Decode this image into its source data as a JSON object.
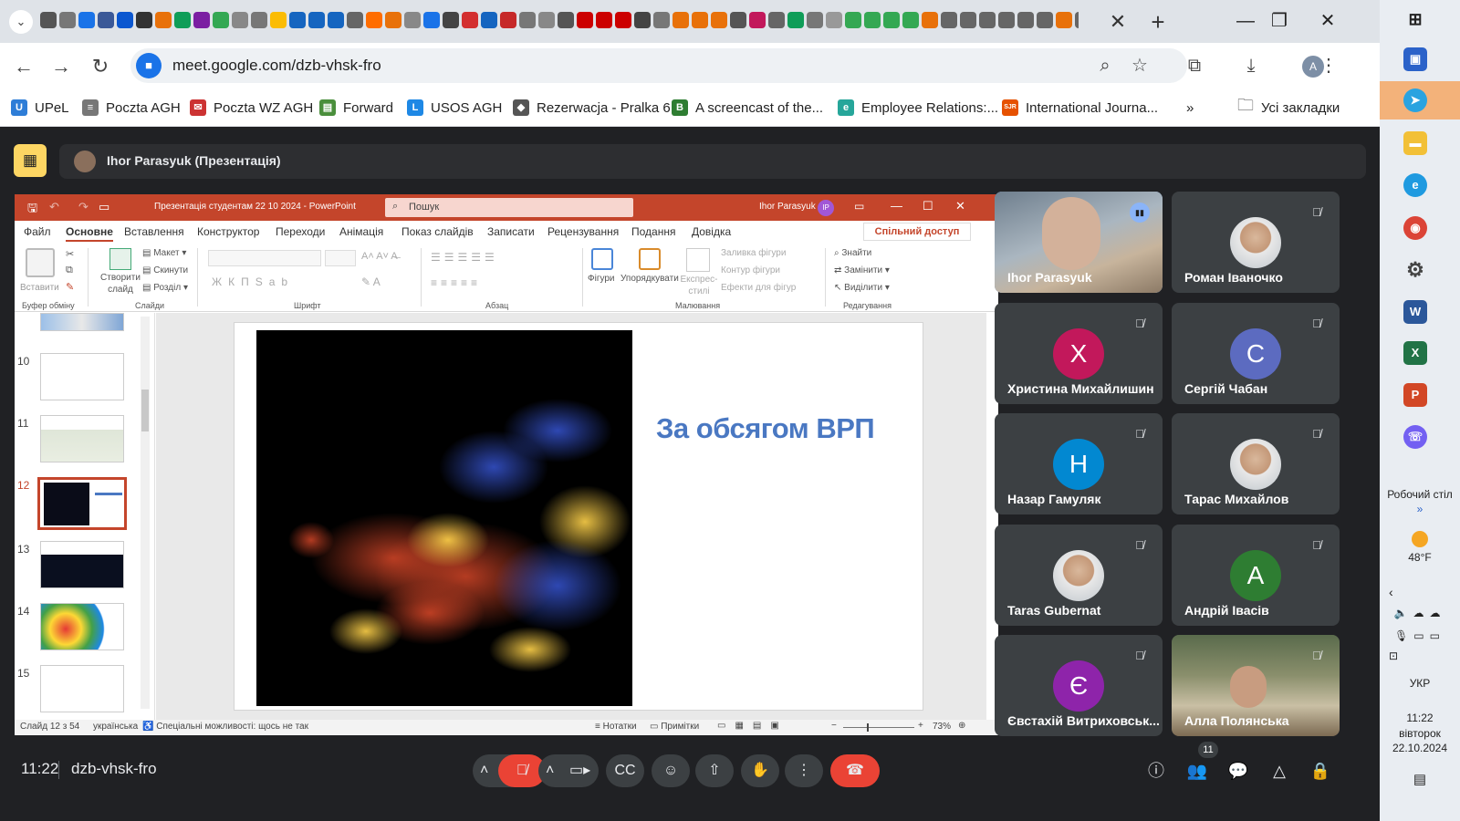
{
  "browser": {
    "url": "meet.google.com/dzb-vhsk-fro",
    "tab_close": "✕",
    "new_tab": "+",
    "tab_favicon_colors": [
      "#555",
      "#777",
      "#1a73e8",
      "#3b5998",
      "#0b57d0",
      "#333",
      "#e8710a",
      "#0f9d58",
      "#7b1fa2",
      "#34a853",
      "#888",
      "#777",
      "#fbbc04",
      "#1565c0",
      "#1565c0",
      "#1565c0",
      "#666",
      "#ff6d00",
      "#e8710a",
      "#888",
      "#1a73e8",
      "#444",
      "#d32f2f",
      "#1565c0",
      "#c62828",
      "#777",
      "#888",
      "#555",
      "#c00",
      "#c00",
      "#c00",
      "#444",
      "#777",
      "#e8710a",
      "#e8710a",
      "#e8710a",
      "#555",
      "#c2185b",
      "#666",
      "#0f9d58",
      "#777",
      "#999",
      "#34a853",
      "#34a853",
      "#34a853",
      "#34a853",
      "#e8710a",
      "#666",
      "#666",
      "#666",
      "#666",
      "#666",
      "#666",
      "#e8710a",
      "#666"
    ]
  },
  "bookmarks": [
    {
      "label": "UPeL",
      "icon": "U",
      "color": "#2e7dd7"
    },
    {
      "label": "Poczta AGH",
      "icon": "≡",
      "color": "#777"
    },
    {
      "label": "Poczta WZ AGH",
      "icon": "✉",
      "color": "#c33"
    },
    {
      "label": "Forward",
      "icon": "▤",
      "color": "#4a8f3c"
    },
    {
      "label": "USOS AGH",
      "icon": "L",
      "color": "#1e88e5"
    },
    {
      "label": "Rezerwacja - Pralka 6",
      "icon": "◆",
      "color": "#555"
    },
    {
      "label": "A screencast of the...",
      "icon": "B",
      "color": "#2e7d32"
    },
    {
      "label": "Employee Relations:...",
      "icon": "e",
      "color": "#26a69a"
    },
    {
      "label": "International Journa...",
      "icon": "SJR",
      "color": "#e65100"
    }
  ],
  "all_bookmarks": "Усі закладки",
  "meet": {
    "presenter_label": "Ihor Parasyuk (Презентація)",
    "time": "11:22",
    "meeting_code": "dzb-vhsk-fro",
    "participants_count": "11",
    "participants": [
      {
        "name": "Ihor Parasyuk",
        "kind": "video",
        "speaking": true
      },
      {
        "name": "Роман Іваночко",
        "kind": "photo",
        "muted": true
      },
      {
        "name": "Христина Михайлишин",
        "kind": "letter",
        "letter": "Х",
        "color": "#c2185b",
        "muted": true
      },
      {
        "name": "Сергій Чабан",
        "kind": "letter",
        "letter": "С",
        "color": "#5c6bc0",
        "muted": true
      },
      {
        "name": "Назар Гамуляк",
        "kind": "letter",
        "letter": "Н",
        "color": "#0288d1",
        "muted": true
      },
      {
        "name": "Тарас Михайлов",
        "kind": "photo",
        "muted": true
      },
      {
        "name": "Taras Gubernat",
        "kind": "photo",
        "muted": true
      },
      {
        "name": "Андрій Івасів",
        "kind": "letter",
        "letter": "А",
        "color": "#2e7d32",
        "muted": true
      },
      {
        "name": "Євстахій Витриховськ...",
        "kind": "letter",
        "letter": "Є",
        "color": "#8e24aa",
        "muted": true
      },
      {
        "name": "Алла Полянська",
        "kind": "video",
        "muted": true
      }
    ]
  },
  "powerpoint": {
    "window_title": "Презентація студентам 22 10 2024 - PowerPoint",
    "search_placeholder": "Пошук",
    "user": "Ihor Parasyuk",
    "user_initials": "IP",
    "tabs": [
      "Файл",
      "Основне",
      "Вставлення",
      "Конструктор",
      "Переходи",
      "Анімація",
      "Показ слайдів",
      "Записати",
      "Рецензування",
      "Подання",
      "Довідка"
    ],
    "share": "Спільний доступ",
    "ribbon": {
      "paste": "Вставити",
      "new_slide": "Створити слайд",
      "layout": "Макет",
      "reset": "Скинути",
      "section": "Розділ",
      "shapes": "Фігури",
      "arrange": "Упорядкувати",
      "quick_styles": "Експрес-стилі",
      "fill": "Заливка фігури",
      "outline": "Контур фігури",
      "effects": "Ефекти для фігур",
      "find": "Знайти",
      "replace": "Замінити",
      "select": "Виділити",
      "groups": [
        "Буфер обміну",
        "Слайди",
        "Шрифт",
        "Абзац",
        "Малювання",
        "Редагування"
      ]
    },
    "thumbnails": [
      {
        "num": "10"
      },
      {
        "num": "11"
      },
      {
        "num": "12",
        "active": true
      },
      {
        "num": "13"
      },
      {
        "num": "14"
      },
      {
        "num": "15"
      }
    ],
    "slide_title": "За обсягом ВРП",
    "status": {
      "slide": "Слайд 12 з 54",
      "language": "українська",
      "accessibility": "Спеціальні можливості: щось не так",
      "notes": "Нотатки",
      "comments": "Примітки",
      "zoom": "73%"
    }
  },
  "taskbar": {
    "desktop": "Робочий стіл",
    "temperature": "48°F",
    "language": "УКР",
    "time": "11:22",
    "day": "вівторок",
    "date": "22.10.2024"
  }
}
